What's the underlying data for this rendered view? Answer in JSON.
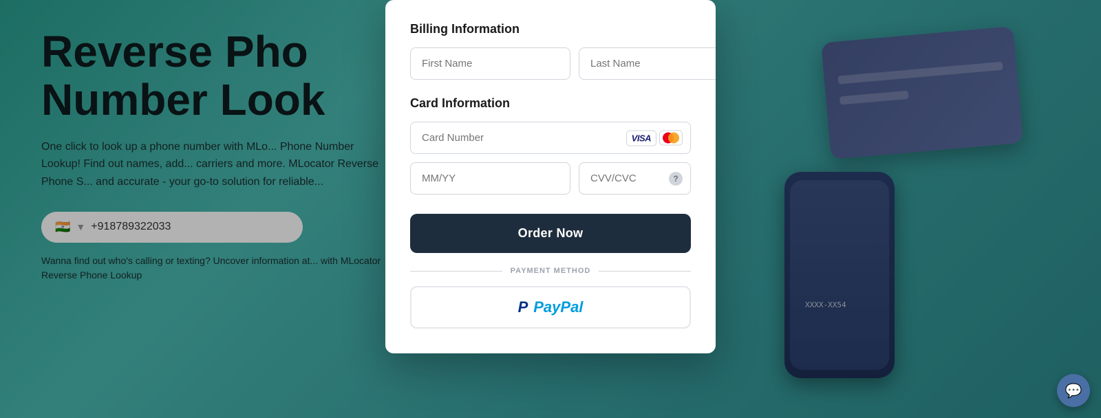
{
  "background": {
    "title": "Reverse Pho...\nNumber Look",
    "title_line1": "Reverse Pho",
    "title_line2": "Number Look",
    "description": "One click to look up a phone number with MLo...\nPhone Number Lookup! Find out names, add...\ncarriers and more. MLocator Reverse Phone S...\nand accurate - your go-to solution for reliable...",
    "phone_placeholder": "+918789322033",
    "phone_flag": "🇮🇳",
    "subtext": "Wanna find out who's calling or texting? Uncover information at...\nwith MLocator Reverse Phone Lookup"
  },
  "modal": {
    "billing_section_title": "Billing Information",
    "first_name_placeholder": "First Name",
    "last_name_placeholder": "Last Name",
    "card_section_title": "Card Information",
    "card_number_placeholder": "Card Number",
    "card_visa_label": "VISA",
    "expiry_placeholder": "MM/YY",
    "cvv_placeholder": "CVV/CVC",
    "order_button_label": "Order Now",
    "payment_method_divider": "PAYMENT METHOD",
    "paypal_p": "P",
    "paypal_label": "PayPal"
  }
}
